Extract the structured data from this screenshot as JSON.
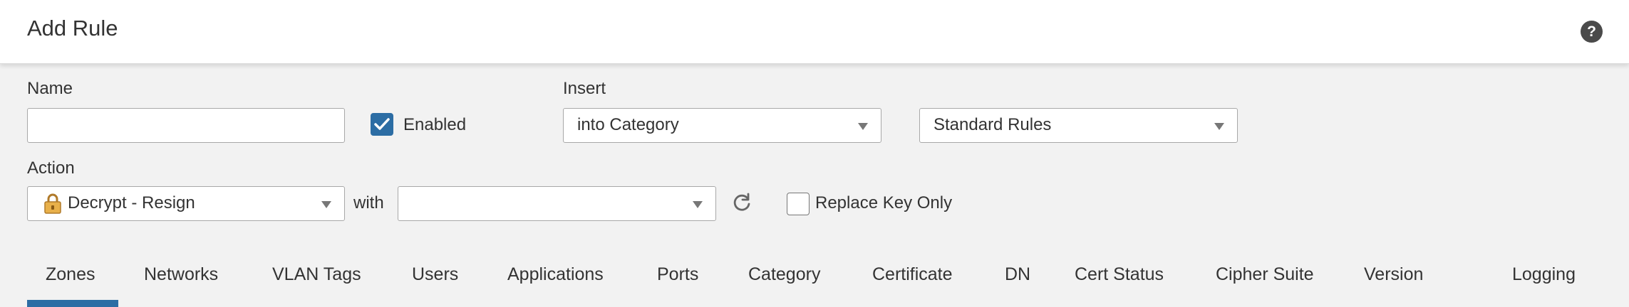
{
  "dialog": {
    "title": "Add Rule"
  },
  "form": {
    "name_label": "Name",
    "name_value": "",
    "enabled_label": "Enabled",
    "enabled_checked": true,
    "insert_label": "Insert",
    "insert_position": "into Category",
    "insert_category": "Standard Rules",
    "action_label": "Action",
    "action_value": "Decrypt - Resign",
    "with_label": "with",
    "with_value": "",
    "replace_key_label": "Replace Key Only",
    "replace_key_checked": false
  },
  "tabs": [
    {
      "label": "Zones",
      "active": true
    },
    {
      "label": "Networks"
    },
    {
      "label": "VLAN Tags"
    },
    {
      "label": "Users"
    },
    {
      "label": "Applications"
    },
    {
      "label": "Ports"
    },
    {
      "label": "Category"
    },
    {
      "label": "Certificate"
    },
    {
      "label": "DN"
    },
    {
      "label": "Cert Status"
    },
    {
      "label": "Cipher Suite"
    },
    {
      "label": "Version"
    },
    {
      "label": "Logging"
    }
  ],
  "icons": {
    "help": "help-icon",
    "action": "lock-icon",
    "refresh": "refresh-icon"
  },
  "colors": {
    "accent": "#2c6da4",
    "background": "#f2f2f2",
    "header": "#ffffff"
  }
}
